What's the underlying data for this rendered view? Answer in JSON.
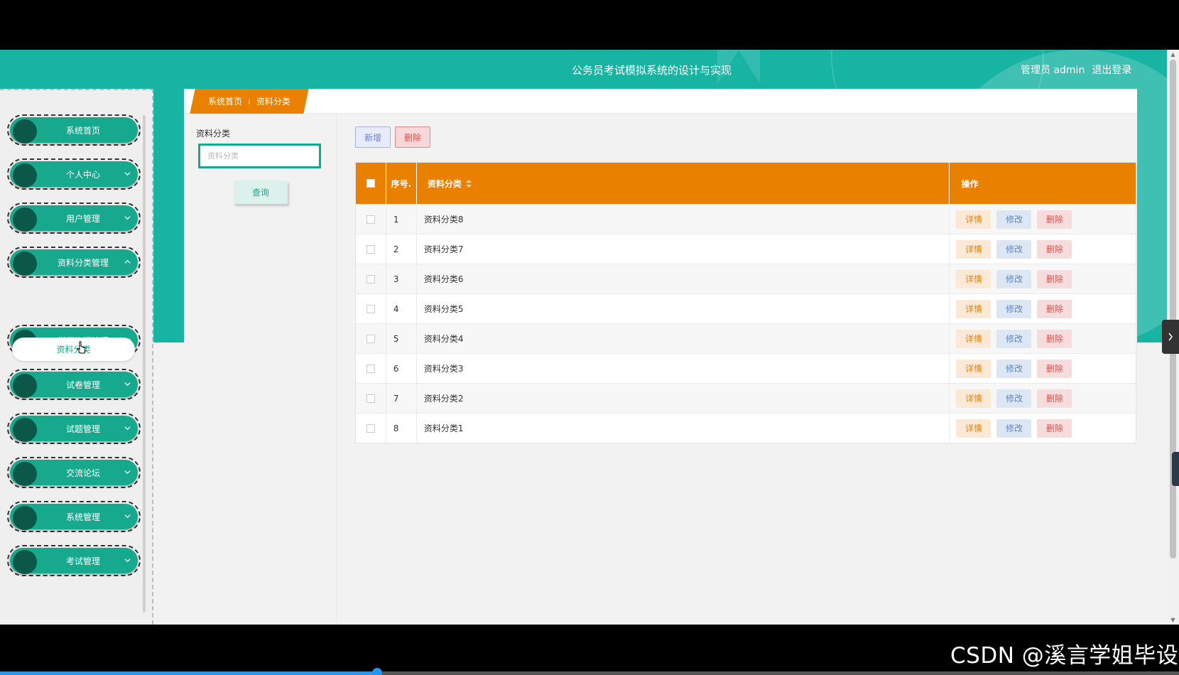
{
  "header": {
    "title": "公务员考试模拟系统的设计与实现",
    "user_label": "管理员 admin",
    "logout": "退出登录"
  },
  "sidebar": {
    "items": [
      {
        "label": "系统首页",
        "chevron": "none"
      },
      {
        "label": "个人中心",
        "chevron": "down"
      },
      {
        "label": "用户管理",
        "chevron": "down"
      },
      {
        "label": "资料分类管理",
        "chevron": "up"
      },
      {
        "label": "学习资源管理",
        "chevron": "down"
      },
      {
        "label": "试卷管理",
        "chevron": "down"
      },
      {
        "label": "试题管理",
        "chevron": "down"
      },
      {
        "label": "交流论坛",
        "chevron": "down"
      },
      {
        "label": "系统管理",
        "chevron": "down"
      },
      {
        "label": "考试管理",
        "chevron": "down"
      }
    ],
    "submenu_active": "资料分类"
  },
  "breadcrumb": {
    "home": "系统首页",
    "separator": "⁝",
    "current": "资料分类"
  },
  "search": {
    "label": "资料分类",
    "placeholder": "资料分类",
    "value": "",
    "query_button": "查询"
  },
  "toolbar": {
    "add_label": "新增",
    "delete_label": "删除"
  },
  "table": {
    "headers": {
      "index": "序号.",
      "name": "资料分类",
      "ops": "操作"
    },
    "rows": [
      {
        "index": "1",
        "name": "资料分类8"
      },
      {
        "index": "2",
        "name": "资料分类7"
      },
      {
        "index": "3",
        "name": "资料分类6"
      },
      {
        "index": "4",
        "name": "资料分类5"
      },
      {
        "index": "5",
        "name": "资料分类4"
      },
      {
        "index": "6",
        "name": "资料分类3"
      },
      {
        "index": "7",
        "name": "资料分类2"
      },
      {
        "index": "8",
        "name": "资料分类1"
      }
    ],
    "op_labels": {
      "detail": "详情",
      "edit": "修改",
      "delete": "删除"
    }
  },
  "watermark": "CSDN @溪言学姐毕设",
  "video_progress": 0.32,
  "colors": {
    "primary_teal": "#17b3a3",
    "menu_green": "#17a98d",
    "accent_orange": "#e98000"
  }
}
